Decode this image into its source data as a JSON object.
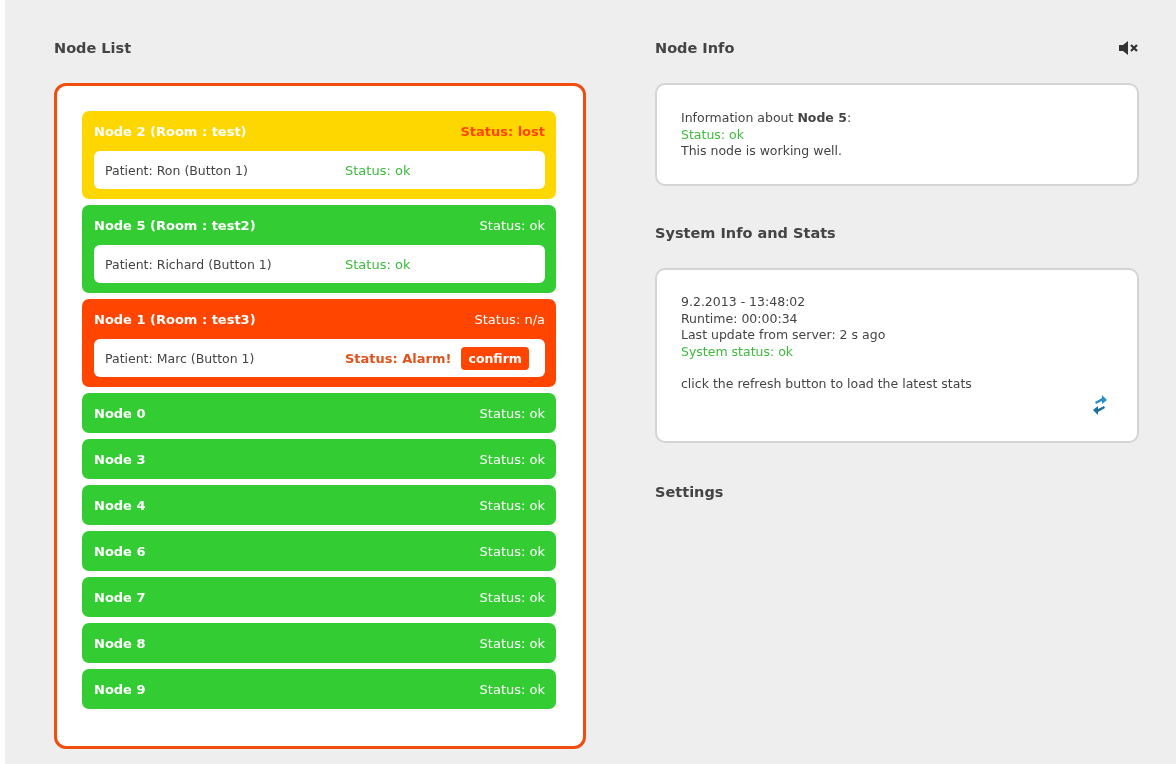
{
  "node_list": {
    "title": "Node List",
    "nodes": [
      {
        "name": "Node 2 (Room : test)",
        "status": "Status: lost",
        "kind": "lost",
        "color": "#ffd700",
        "patients": [
          {
            "name": "Patient: Ron (Button 1)",
            "status": "Status: ok",
            "kind": "ok"
          }
        ]
      },
      {
        "name": "Node 5 (Room : test2)",
        "status": "Status: ok",
        "kind": "ok",
        "color": "#33cc33",
        "patients": [
          {
            "name": "Patient: Richard (Button 1)",
            "status": "Status: ok",
            "kind": "ok"
          }
        ]
      },
      {
        "name": "Node 1 (Room : test3)",
        "status": "Status: n/a",
        "kind": "ok",
        "color": "#ff4500",
        "patients": [
          {
            "name": "Patient: Marc (Button 1)",
            "status": "Status: Alarm!",
            "kind": "alarm",
            "action": "confirm"
          }
        ]
      },
      {
        "name": "Node 0",
        "status": "Status: ok",
        "kind": "ok",
        "color": "#33cc33"
      },
      {
        "name": "Node 3",
        "status": "Status: ok",
        "kind": "ok",
        "color": "#33cc33"
      },
      {
        "name": "Node 4",
        "status": "Status: ok",
        "kind": "ok",
        "color": "#33cc33"
      },
      {
        "name": "Node 6",
        "status": "Status: ok",
        "kind": "ok",
        "color": "#33cc33"
      },
      {
        "name": "Node 7",
        "status": "Status: ok",
        "kind": "ok",
        "color": "#33cc33"
      },
      {
        "name": "Node 8",
        "status": "Status: ok",
        "kind": "ok",
        "color": "#33cc33"
      },
      {
        "name": "Node 9",
        "status": "Status: ok",
        "kind": "ok",
        "color": "#33cc33"
      }
    ]
  },
  "node_info": {
    "title": "Node Info",
    "muted": true,
    "lines": [
      {
        "text": "Information about **Node 5**:",
        "kind": "plain"
      },
      {
        "text": "Status: ok",
        "kind": "ok"
      },
      {
        "text": "This node is working well.",
        "kind": "plain"
      }
    ]
  },
  "system_info": {
    "title": "System Info and Stats",
    "lines": [
      {
        "text": "9.2.2013 - 13:48:02",
        "kind": "plain"
      },
      {
        "text": "Runtime: 00:00:34",
        "kind": "plain"
      },
      {
        "text": "Last update from server: 2 s ago",
        "kind": "plain"
      },
      {
        "text": "System status: ok",
        "kind": "ok"
      },
      {
        "text": "click the refresh button to load the latest stats",
        "kind": "note"
      }
    ]
  },
  "settings": {
    "title": "Settings"
  }
}
